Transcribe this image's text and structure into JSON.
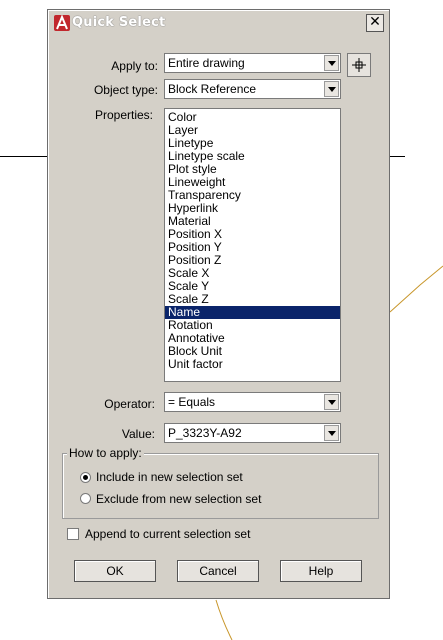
{
  "window": {
    "title": "Quick Select"
  },
  "fields": {
    "apply_to": {
      "label": "Apply to:",
      "value": "Entire drawing"
    },
    "object_type": {
      "label": "Object type:",
      "value": "Block Reference"
    },
    "properties": {
      "label": "Properties:",
      "items": [
        "Color",
        "Layer",
        "Linetype",
        "Linetype scale",
        "Plot style",
        "Lineweight",
        "Transparency",
        "Hyperlink",
        "Material",
        "Position X",
        "Position Y",
        "Position Z",
        "Scale X",
        "Scale Y",
        "Scale Z",
        "Name",
        "Rotation",
        "Annotative",
        "Block Unit",
        "Unit factor"
      ],
      "selected": "Name"
    },
    "operator": {
      "label": "Operator:",
      "value": "= Equals"
    },
    "value": {
      "label": "Value:",
      "value": "P_3323Y-A92"
    }
  },
  "how_to_apply": {
    "title": "How to apply:",
    "include_label": "Include in new selection set",
    "exclude_label": "Exclude from new selection set",
    "selected": "include"
  },
  "append": {
    "label": "Append to current selection set",
    "checked": false
  },
  "buttons": {
    "ok": "OK",
    "cancel": "Cancel",
    "help": "Help"
  },
  "icons": {
    "app": "autocad-logo-icon",
    "close": "close-icon",
    "pick": "select-objects-icon",
    "dropdown": "chevron-down-icon"
  },
  "colors": {
    "dialog_bg": "#d4d0c8",
    "selection": "#0a246a",
    "app_icon": "#c1272d",
    "background_curve": "#c8962a"
  }
}
